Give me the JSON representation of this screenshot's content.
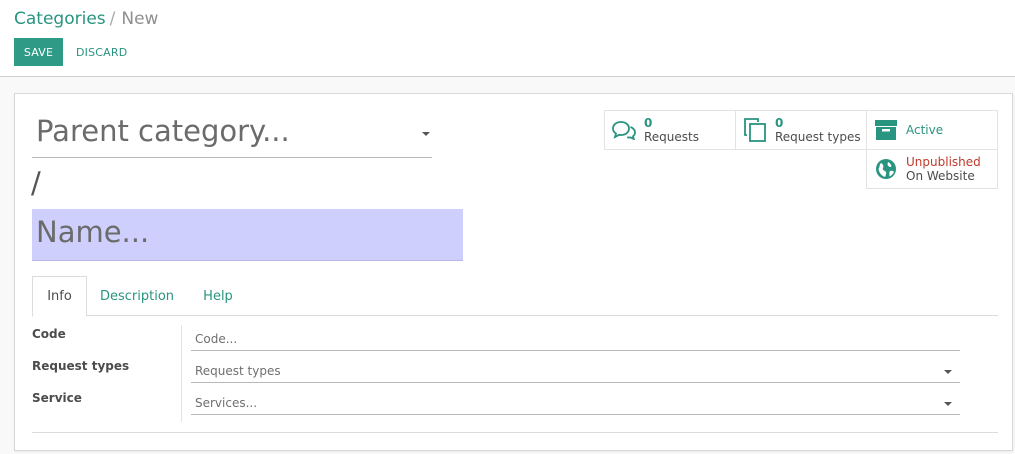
{
  "breadcrumb": {
    "parent": "Categories",
    "separator": "/",
    "current": "New"
  },
  "toolbar": {
    "save_label": "SAVE",
    "discard_label": "DISCARD"
  },
  "form": {
    "parent_category_placeholder": "Parent category...",
    "separator": "/",
    "name_placeholder": "Name..."
  },
  "smart_buttons": {
    "requests": {
      "count": "0",
      "label": "Requests",
      "icon": "comments-icon"
    },
    "request_types": {
      "count": "0",
      "label": "Request types",
      "icon": "copy-icon"
    },
    "active": {
      "label": "Active",
      "icon": "archive-icon"
    },
    "website": {
      "status": "Unpublished",
      "label": "On Website",
      "icon": "globe-icon"
    }
  },
  "tabs": [
    {
      "label": "Info",
      "active": true
    },
    {
      "label": "Description",
      "active": false
    },
    {
      "label": "Help",
      "active": false
    }
  ],
  "fields": {
    "code": {
      "label": "Code",
      "placeholder": "Code..."
    },
    "request_types": {
      "label": "Request types",
      "placeholder": "Request types"
    },
    "service": {
      "label": "Service",
      "placeholder": "Services..."
    }
  },
  "colors": {
    "accent": "#29947f",
    "save_button": "#2f9b87",
    "unpublished": "#c0392b",
    "name_highlight": "#cfcffe"
  }
}
